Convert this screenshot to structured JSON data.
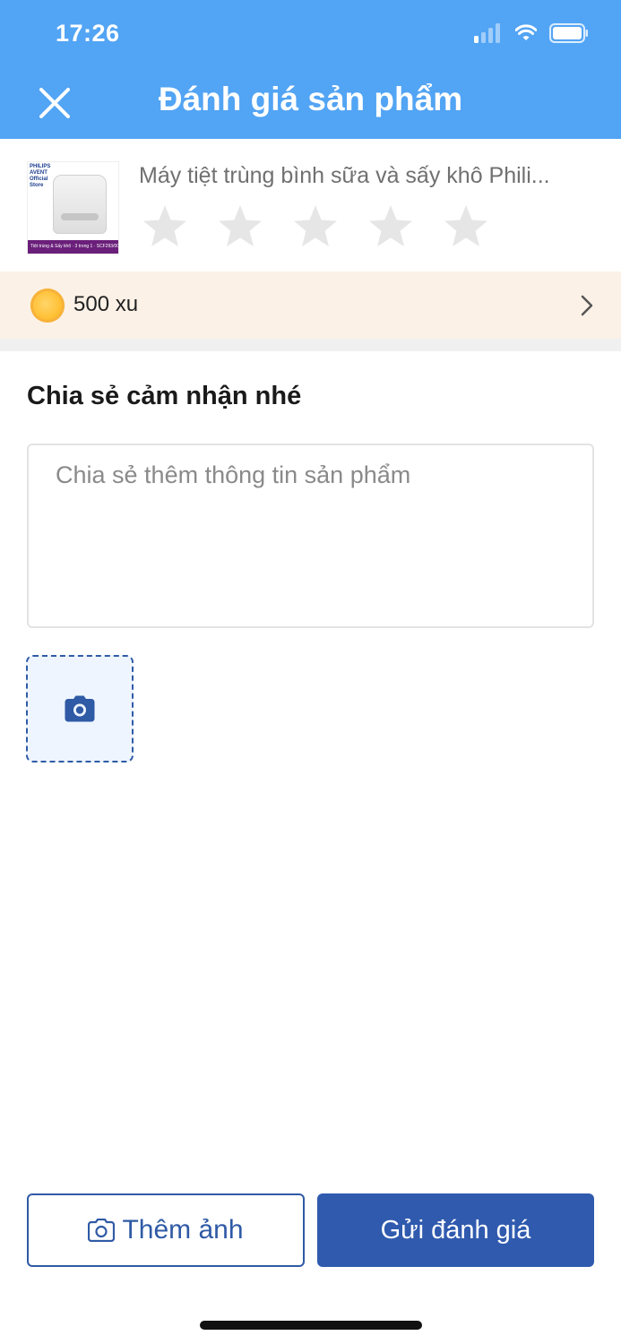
{
  "status_bar": {
    "time": "17:26"
  },
  "header": {
    "title": "Đánh giá sản phẩm"
  },
  "product": {
    "name": "Máy tiệt trùng bình sữa và sấy khô Phili...",
    "thumb_brand": "PHILIPS AVENT Official Store",
    "thumb_band": "Tiệt trùng & Sấy khô · 3 trong 1 · SCF293/00",
    "rating": {
      "selected": 0,
      "max": 5
    }
  },
  "reward": {
    "label": "500 xu"
  },
  "review": {
    "section_title": "Chia sẻ cảm nhận nhé",
    "placeholder": "Chia sẻ thêm thông tin sản phẩm",
    "value": ""
  },
  "actions": {
    "add_photo_label": "Thêm ảnh",
    "submit_label": "Gửi đánh giá"
  },
  "colors": {
    "header_bg": "#52a4f4",
    "accent": "#2f5aa5",
    "reward_bg": "#fbf1e6",
    "star_inactive": "#e6e6e6"
  },
  "icons": {
    "close": "close-icon",
    "star": "star-icon",
    "coin": "coin-icon",
    "chevron": "chevron-right-icon",
    "camera": "camera-icon"
  }
}
